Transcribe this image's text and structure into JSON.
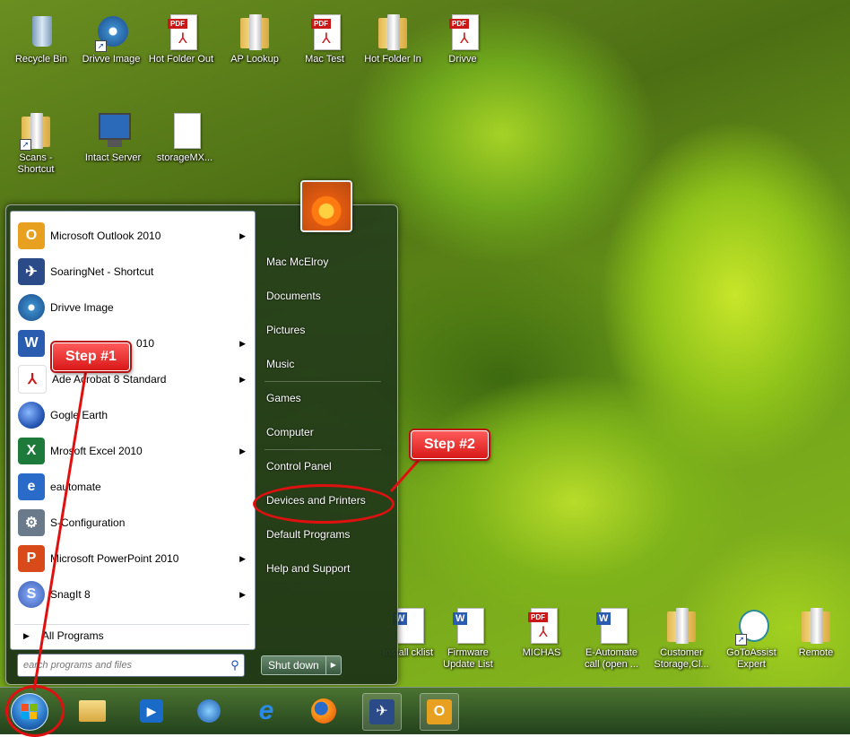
{
  "desktop_icons": [
    {
      "name": "recycle-bin",
      "label": "Recycle Bin",
      "kind": "bin"
    },
    {
      "name": "drivve-image",
      "label": "Drivve Image",
      "kind": "disc"
    },
    {
      "name": "hot-folder-out",
      "label": "Hot Folder Out",
      "kind": "pdf"
    },
    {
      "name": "ap-lookup",
      "label": "AP Lookup",
      "kind": "folder"
    },
    {
      "name": "mac-test",
      "label": "Mac Test",
      "kind": "pdf"
    },
    {
      "name": "hot-folder-in",
      "label": "Hot Folder In",
      "kind": "folder"
    },
    {
      "name": "drivve",
      "label": "Drivve",
      "kind": "pdf"
    },
    {
      "name": "scans-shortcut",
      "label": "Scans - Shortcut",
      "kind": "folder"
    },
    {
      "name": "intact-server",
      "label": "Intact Server",
      "kind": "monitor"
    },
    {
      "name": "storagemx",
      "label": "storageMX...",
      "kind": "doc"
    },
    {
      "name": "install-checklist",
      "label": "Install cklist",
      "kind": "word"
    },
    {
      "name": "firmware-update-list",
      "label": "Firmware Update List",
      "kind": "word"
    },
    {
      "name": "michas",
      "label": "MICHAS",
      "kind": "pdf"
    },
    {
      "name": "e-automate-call",
      "label": "E-Automate call (open ...",
      "kind": "word"
    },
    {
      "name": "customer-storage",
      "label": "Customer Storage,Cl...",
      "kind": "folder"
    },
    {
      "name": "gotoassist-expert",
      "label": "GoToAssist Expert",
      "kind": "gota"
    },
    {
      "name": "remote",
      "label": "Remote",
      "kind": "folder"
    }
  ],
  "start_menu": {
    "programs": [
      {
        "label": "Microsoft Outlook 2010",
        "arrow": true,
        "icon": "outlook",
        "glyph": "O",
        "color": "#e8a020"
      },
      {
        "label": "SoaringNet - Shortcut",
        "arrow": false,
        "icon": "soaringnet",
        "glyph": "✈",
        "color": "#2a4a88"
      },
      {
        "label": "Drivve Image",
        "arrow": false,
        "icon": "drivve",
        "glyph": "◉",
        "color": "#3a8ac8"
      },
      {
        "label": "010",
        "arrow": true,
        "icon": "word",
        "glyph": "W",
        "color": "#2a5cb0"
      },
      {
        "label": "e Acrobat 8 Standard",
        "prefix": "Ad",
        "arrow": true,
        "icon": "acrobat",
        "glyph": "⅄",
        "color": "#c81818"
      },
      {
        "label": "gle Earth",
        "prefix": "Go",
        "arrow": false,
        "icon": "google-earth",
        "glyph": "◍",
        "color": "#2a5ab8"
      },
      {
        "label": "rosoft Excel 2010",
        "prefix": "M",
        "arrow": true,
        "icon": "excel",
        "glyph": "X",
        "color": "#1e7a3a"
      },
      {
        "label": "automate",
        "prefix": "e",
        "arrow": false,
        "icon": "e-automate",
        "glyph": "e",
        "color": "#2a6ac8"
      },
      {
        "label": "S-Configuration",
        "arrow": false,
        "icon": "configuration",
        "glyph": "⚙",
        "color": "#6a7a8a"
      },
      {
        "label": "Microsoft PowerPoint 2010",
        "arrow": true,
        "icon": "powerpoint",
        "glyph": "P",
        "color": "#d84a1a"
      },
      {
        "label": "SnagIt 8",
        "arrow": true,
        "icon": "snagit",
        "glyph": "S",
        "color": "#3a5ab0"
      }
    ],
    "all_programs": "All Programs",
    "search_placeholder": "earch programs and files",
    "right_items": [
      "Mac McElroy",
      "Documents",
      "Pictures",
      "Music",
      "Games",
      "Computer",
      "Control Panel",
      "Devices and Printers",
      "Default Programs",
      "Help and Support"
    ],
    "shutdown": "Shut down"
  },
  "annotations": {
    "step1": "Step #1",
    "step2": "Step #2"
  },
  "taskbar": [
    "windows-explorer",
    "media-player",
    "network",
    "internet-explorer",
    "firefox",
    "soaringnet",
    "outlook"
  ],
  "colors": {
    "annotation_red": "#e01010",
    "menu_panel": "#2a4a20"
  }
}
